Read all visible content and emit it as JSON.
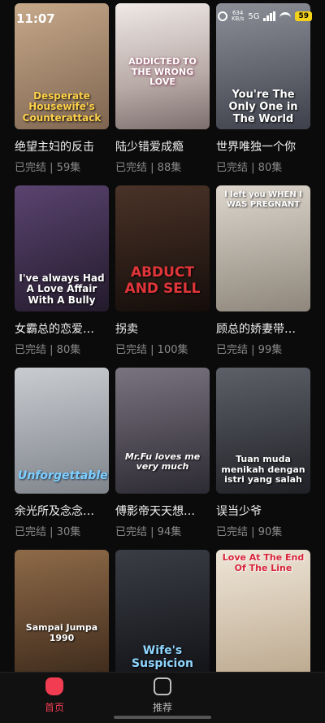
{
  "status": {
    "time": "11:07",
    "net_speed": "634",
    "net_unit": "KB/s",
    "signal_label": "5G",
    "battery": "59"
  },
  "dramas": [
    {
      "poster_text": "Desperate Housewife's Counterattack",
      "title": "绝望主妇的反击",
      "status": "已完结",
      "episodes": "59集",
      "bg": "#a08a70",
      "text_color": "#ffd24a"
    },
    {
      "poster_text": "ADDICTED TO THE WRONG LOVE",
      "title": "陆少错爱成瘾",
      "status": "已完结",
      "episodes": "88集",
      "bg": "#d8cfcf",
      "text_color": "#ffffff"
    },
    {
      "poster_text": "You're The Only One in The World",
      "title": "世界唯独一个你",
      "status": "已完结",
      "episodes": "80集",
      "bg": "#5a5e6a",
      "text_color": "#ffffff"
    },
    {
      "poster_text": "I've always Had A Love Affair With A Bully",
      "title": "女霸总的恋爱…",
      "status": "已完结",
      "episodes": "80集",
      "bg": "#3d2c4a",
      "text_color": "#ffffff"
    },
    {
      "poster_text": "ABDUCT AND SELL",
      "title": "拐卖",
      "status": "已完结",
      "episodes": "100集",
      "bg": "#2a1a14",
      "text_color": "#e2353a"
    },
    {
      "poster_text": "I left you WHEN I WAS PREGNANT",
      "title": "顾总的娇妻带…",
      "status": "已完结",
      "episodes": "99集",
      "bg": "#b9b2a8",
      "text_color": "#ffffff"
    },
    {
      "poster_text": "Unforgettable",
      "title": "余光所及念念…",
      "status": "已完结",
      "episodes": "30集",
      "bg": "#9a9fa6",
      "text_color": "#7fd0ff"
    },
    {
      "poster_text": "Mr.Fu loves me very much",
      "title": "傅影帝天天想…",
      "status": "已完结",
      "episodes": "94集",
      "bg": "#54525c",
      "text_color": "#ffffff"
    },
    {
      "poster_text": "Tuan muda menikah dengan istri yang salah",
      "title": "误当少爷",
      "status": "已完结",
      "episodes": "90集",
      "bg": "#3c3c42",
      "text_color": "#ffffff"
    },
    {
      "poster_text": "Sampai Jumpa 1990",
      "title": "",
      "status": "",
      "episodes": "",
      "bg": "#6b4d35",
      "text_color": "#ffffff"
    },
    {
      "poster_text": "Wife's Suspicion",
      "title": "",
      "status": "",
      "episodes": "",
      "bg": "#1f2228",
      "text_color": "#8fd6ff"
    },
    {
      "poster_text": "Love At The End Of The Line",
      "title": "",
      "status": "",
      "episodes": "",
      "bg": "#d9cbb8",
      "text_color": "#d8243a"
    }
  ],
  "nav": {
    "home_label": "首页",
    "home_color": "#f23c52",
    "recommend_label": "推荐",
    "recommend_color": "#bdbdbd"
  }
}
